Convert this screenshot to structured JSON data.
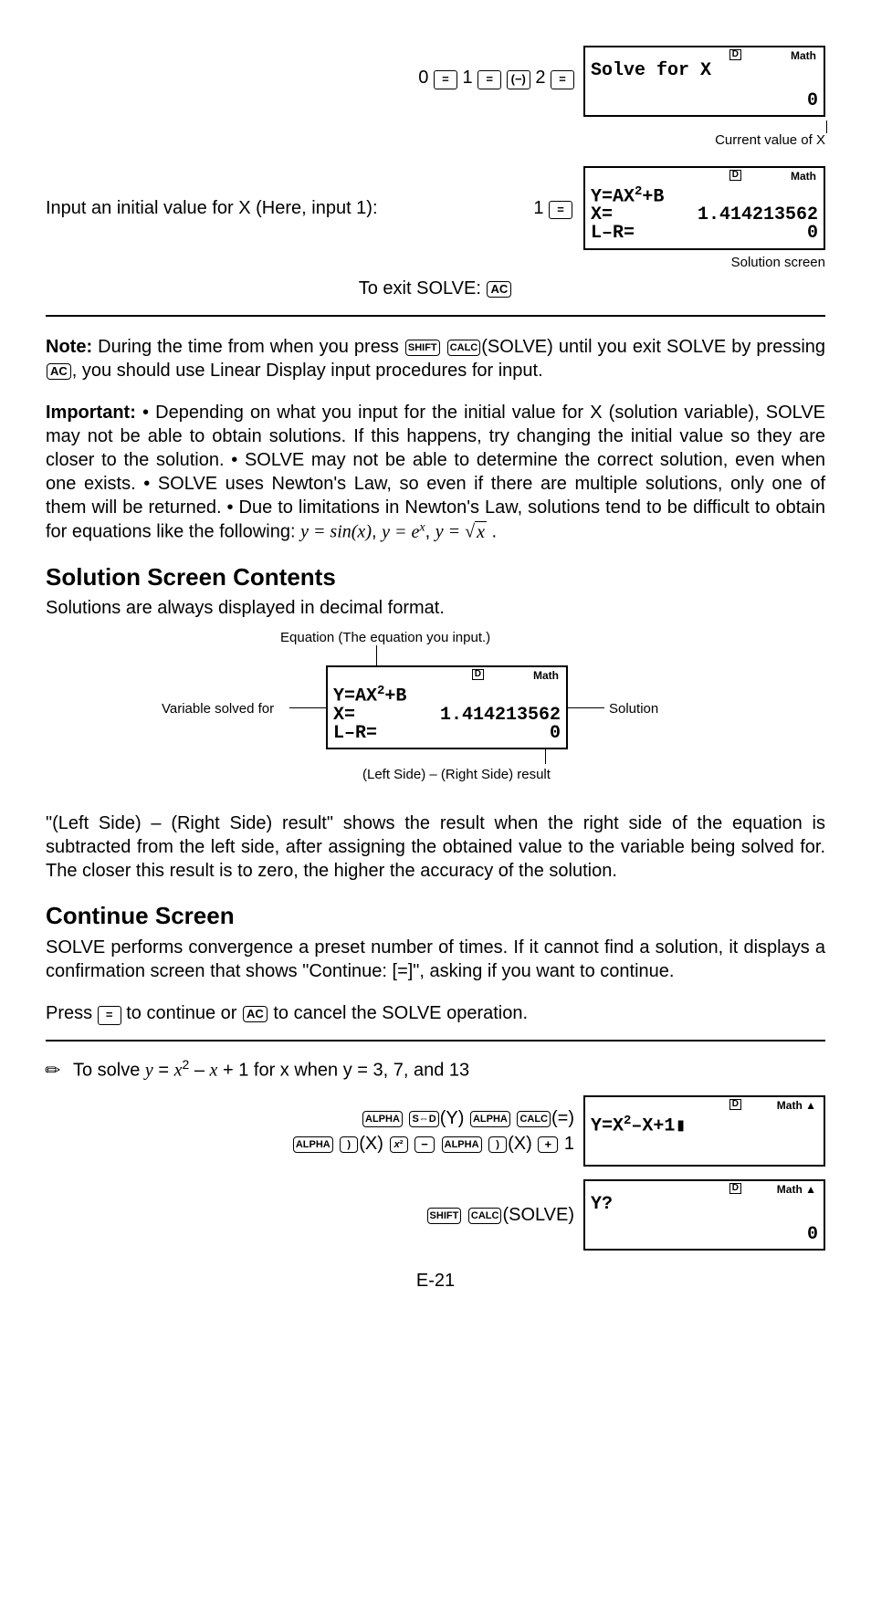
{
  "seq1_parts": {
    "p1": "0",
    "p2": "1",
    "p3": "2"
  },
  "lcd1": {
    "line1": "Solve for X",
    "bottom": "0",
    "math": "Math"
  },
  "caption1": "Current value of X",
  "text_input_initial": "Input an initial value for X (Here, input 1):",
  "seq2": "1",
  "lcd2": {
    "l1": "Y=AX",
    "l1b": "+B",
    "l2a": "X=",
    "l2b": "1.414213562",
    "l3a": "L–R=",
    "l3b": "0",
    "math": "Math",
    "sup": "2"
  },
  "caption2": "Solution screen",
  "exit_text": "To exit SOLVE:",
  "note_label": "Note:",
  "note_body": " During the time from when you press ",
  "note_body2": "(SOLVE) until you exit SOLVE by pressing ",
  "note_body3": ", you should use Linear Display input procedures for input.",
  "important_label": "Important:",
  "important_body": "  • Depending on what you input for the initial value for X (solution variable), SOLVE may not be able to obtain solutions. If this happens, try changing the initial value so they are closer to the solution.  • SOLVE may not be able to determine the correct solution, even when one exists.  • SOLVE uses Newton's Law, so even if there are multiple solutions, only one of them will be returned.  • Due to limitations in Newton's Law, solutions tend to be difficult to obtain for equations like the following: ",
  "eq_examples": {
    "a": "y = sin(x)",
    "b": "y = e",
    "c": "y = ",
    "sqrt": "x",
    "sup": "x"
  },
  "h2a": "Solution Screen Contents",
  "p_decimal": "Solutions are always displayed in decimal format.",
  "annot": {
    "eq": "Equation (The equation you input.)",
    "var": "Variable solved for",
    "sol": "Solution",
    "lr": "(Left Side) – (Right Side) result"
  },
  "p_lr": "\"(Left Side) – (Right Side) result\" shows the result when the right side of the equation is subtracted from the left side, after assigning the obtained value to the variable being solved for. The closer this result is to zero, the higher the accuracy of the solution.",
  "h2b": "Continue Screen",
  "p_cont1": "SOLVE performs convergence a preset number of times. If it cannot find a solution, it displays a confirmation screen that shows \"Continue: [=]\", asking if you want to continue.",
  "p_cont2a": "Press ",
  "p_cont2b": " to continue or ",
  "p_cont2c": " to cancel the SOLVE operation.",
  "example_intro": "To solve ",
  "example_eq": "y = x² – x + 1",
  "example_for": " for x when y = 3, 7, and 13",
  "keys": {
    "shift": "SHIFT",
    "calc": "CALC",
    "ac": "AC",
    "eq": "=",
    "alpha": "ALPHA",
    "sd": "S⇔D",
    "rparen": ")",
    "x2": "x²",
    "minus": "−",
    "plus": "+",
    "neg": "(−)"
  },
  "key_labels": {
    "Y": "(Y)",
    "X": "(X)",
    "eq": "(=)",
    "solve": "(SOLVE)"
  },
  "seq3_tail": "1",
  "lcd3": {
    "content": "Y=X",
    "sup": "2",
    "rest": "–X+1",
    "cursor": "▮",
    "math": "Math ▲"
  },
  "lcd4": {
    "content": "Y?",
    "bottom": "0",
    "math": "Math ▲"
  },
  "page": "E-21"
}
